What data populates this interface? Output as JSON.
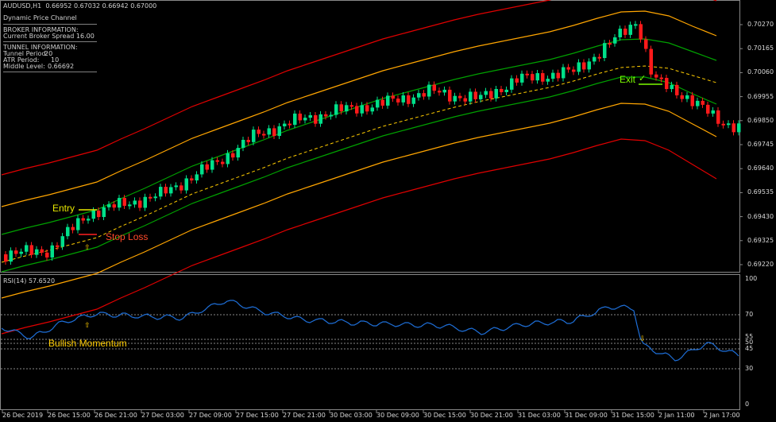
{
  "header": {
    "symbol_line": "AUDUSD,H1  0.66952 0.67032 0.66942 0.67000"
  },
  "info_panel": {
    "indicator_name": "Dynamic Price Channel",
    "broker_title": "BROKER INFORMATION:",
    "broker_spread": "Current Broker Spread 16.00",
    "tunnel_title": "TUNNEL INFORMATION:",
    "tunnel_period_label": "Tunnel Period:",
    "tunnel_period_value": "20",
    "atr_period_label": "ATR Period:",
    "atr_period_value": "10",
    "middle_level_label": "Middle Level:",
    "middle_level_value": "0.66692"
  },
  "price_axis": [
    "0.70270",
    "0.70165",
    "0.70060",
    "0.69955",
    "0.69850",
    "0.69745",
    "0.69640",
    "0.69535",
    "0.69430",
    "0.69325",
    "0.69220"
  ],
  "rsi": {
    "label": "RSI(14) 57.6520",
    "levels": [
      "100",
      "70",
      "55",
      "50",
      "45",
      "30",
      "0"
    ]
  },
  "time_axis": [
    "26 Dec 2019",
    "26 Dec 15:00",
    "26 Dec 21:00",
    "27 Dec 03:00",
    "27 Dec 09:00",
    "27 Dec 15:00",
    "27 Dec 21:00",
    "30 Dec 03:00",
    "30 Dec 09:00",
    "30 Dec 15:00",
    "30 Dec 21:00",
    "31 Dec 03:00",
    "31 Dec 09:00",
    "31 Dec 15:00",
    "2 Jan 11:00",
    "2 Jan 17:00"
  ],
  "annotations": {
    "entry": "Entry",
    "stop_loss": "Stop Loss",
    "exit": "Exit",
    "exit_mark": "✓",
    "bullish_momentum": "Bullish Momentum",
    "up_arrow": "⇧"
  },
  "colors": {
    "background": "#000000",
    "bull_candle": "#00e08a",
    "bear_candle": "#ff1a1a",
    "outer_band": "#e00000",
    "middle_band": "#ffa500",
    "inner_band": "#00a000",
    "middle_level": "#ffcc00",
    "rsi_line": "#1e6fd9",
    "entry_text": "#e8e800",
    "stop_text": "#ff4a2a",
    "exit_text": "#7cfc00",
    "momentum_text": "#ffcc00"
  }
}
